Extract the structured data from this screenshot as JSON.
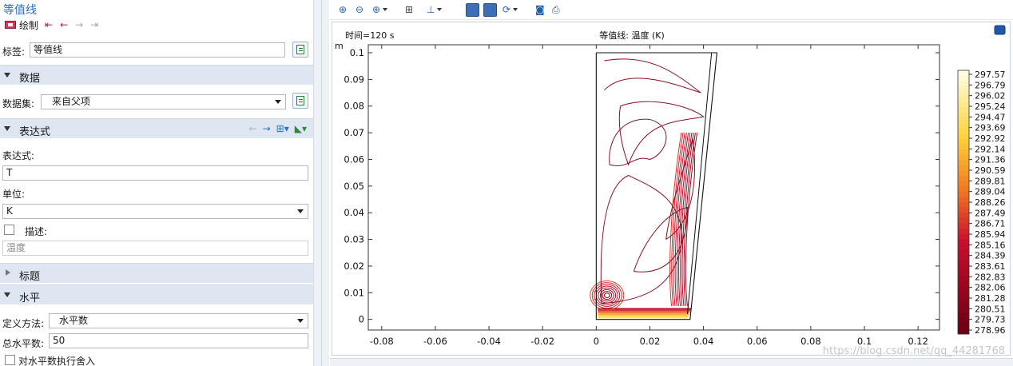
{
  "panel": {
    "title": "等值线",
    "plot_label": "绘制",
    "label_field": {
      "label": "标签:",
      "value": "等值线"
    },
    "data_section": {
      "title": "数据",
      "dataset_label": "数据集:",
      "dataset_value": "来自父项"
    },
    "expression_section": {
      "title": "表达式",
      "expression_label": "表达式:",
      "expression_value": "T",
      "unit_label": "单位:",
      "unit_value": "K",
      "description_label": "描述:",
      "description_value": "温度"
    },
    "title_section": {
      "title": "标题"
    },
    "levels_section": {
      "title": "水平",
      "method_label": "定义方法:",
      "method_value": "水平数",
      "total_label": "总水平数:",
      "total_value": "50",
      "round_label": "对水平数执行舍入"
    }
  },
  "plot": {
    "time_label": "时间=120 s",
    "title": "等值线: 温度 (K)",
    "unit_label": "m",
    "watermark": "https://blog.csdn.net/qq_44281768",
    "x_ticks": [
      "-0.08",
      "-0.06",
      "-0.04",
      "-0.02",
      "0",
      "0.02",
      "0.04",
      "0.06",
      "0.08",
      "0.1",
      "0.12"
    ],
    "y_ticks": [
      "0",
      "0.01",
      "0.02",
      "0.03",
      "0.04",
      "0.05",
      "0.06",
      "0.07",
      "0.08",
      "0.09",
      "0.1"
    ],
    "colorbar_labels": [
      "297.57",
      "296.79",
      "296.02",
      "295.24",
      "294.47",
      "293.69",
      "292.92",
      "292.14",
      "291.36",
      "290.59",
      "289.81",
      "289.04",
      "288.26",
      "287.49",
      "286.71",
      "285.94",
      "285.16",
      "284.39",
      "283.61",
      "282.83",
      "282.06",
      "281.28",
      "280.51",
      "279.73",
      "278.96"
    ]
  },
  "chart_data": {
    "type": "contour",
    "title": "等值线: 温度 (K)",
    "annotation": "时间=120 s",
    "xlabel": "m",
    "ylabel": "m",
    "xlim": [
      -0.085,
      0.128
    ],
    "ylim": [
      -0.004,
      0.103
    ],
    "x_ticks": [
      -0.08,
      -0.06,
      -0.04,
      -0.02,
      0,
      0.02,
      0.04,
      0.06,
      0.08,
      0.1,
      0.12
    ],
    "y_ticks": [
      0,
      0.01,
      0.02,
      0.03,
      0.04,
      0.05,
      0.06,
      0.07,
      0.08,
      0.09,
      0.1
    ],
    "levels": 50,
    "color_range": [
      278.96,
      297.57
    ],
    "domain_outline": [
      [
        0,
        0.1
      ],
      [
        0.045,
        0.1
      ],
      [
        0.035,
        0
      ],
      [
        0,
        0
      ],
      [
        0,
        0.1
      ]
    ],
    "colors": {
      "high": "#fdfde0",
      "mid": "#f5a623",
      "low": "#6b0012",
      "line": "#8a1020"
    }
  }
}
